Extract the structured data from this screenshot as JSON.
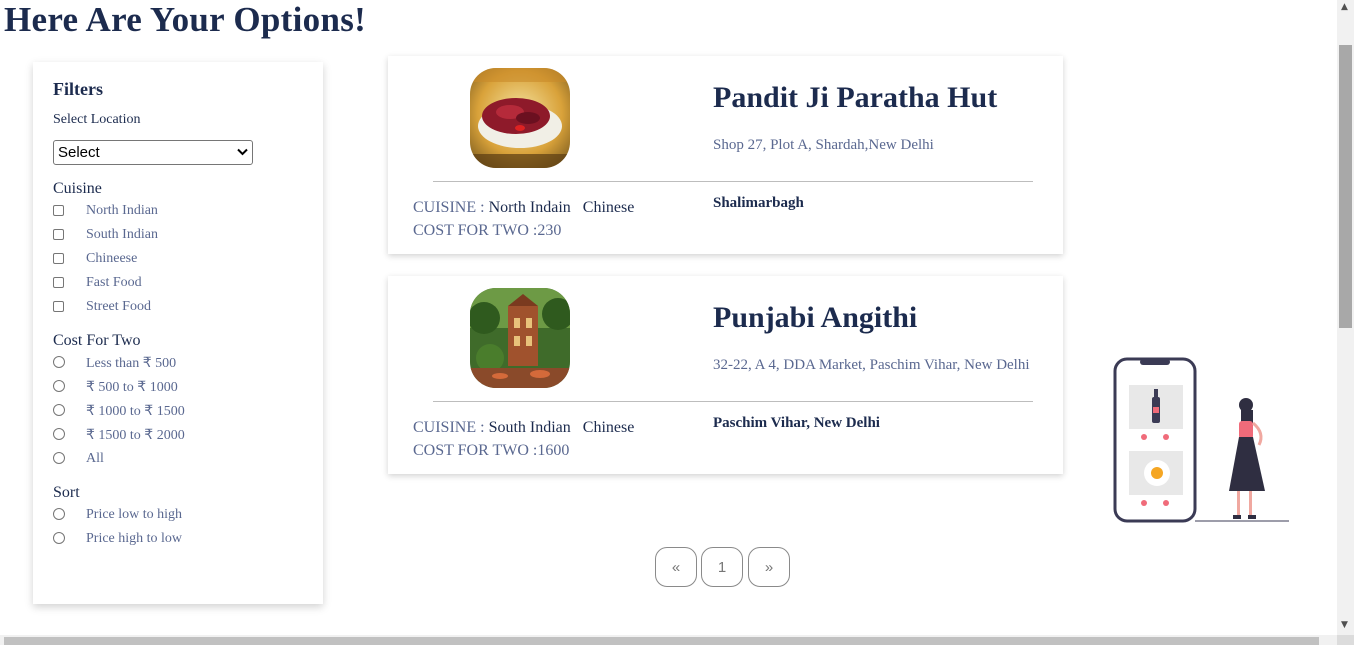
{
  "page": {
    "title": "Here Are Your Options!"
  },
  "filters": {
    "heading": "Filters",
    "location_label": "Select Location",
    "location_selected": "Select",
    "cuisine_title": "Cuisine",
    "cuisines": [
      "North Indian",
      "South Indian",
      "Chineese",
      "Fast Food",
      "Street Food"
    ],
    "cost_title": "Cost For Two",
    "costs": [
      "Less than ₹ 500",
      "₹ 500 to ₹ 1000",
      "₹ 1000 to ₹ 1500",
      "₹ 1500 to ₹ 2000",
      "All"
    ],
    "sort_title": "Sort",
    "sorts": [
      "Price low to high",
      "Price high to low"
    ]
  },
  "restaurants": [
    {
      "name": "Pandit Ji Paratha Hut",
      "address": "Shop 27, Plot A, Shardah,New Delhi",
      "cuisine_label": "CUISINE : ",
      "cuisine": "North Indain   Chinese",
      "cost_label": "COST FOR TWO :",
      "cost": "230",
      "locality": "Shalimarbagh"
    },
    {
      "name": "Punjabi Angithi",
      "address": "32-22, A 4, DDA Market, Paschim Vihar, New Delhi",
      "cuisine_label": "CUISINE : ",
      "cuisine": "South Indian   Chinese",
      "cost_label": "COST FOR TWO :",
      "cost": "1600",
      "locality": "Paschim Vihar, New Delhi"
    }
  ],
  "pagination": {
    "prev": "«",
    "page": "1",
    "next": "»"
  },
  "colors": {
    "heading": "#1c2b4e",
    "muted": "#5a6890"
  }
}
